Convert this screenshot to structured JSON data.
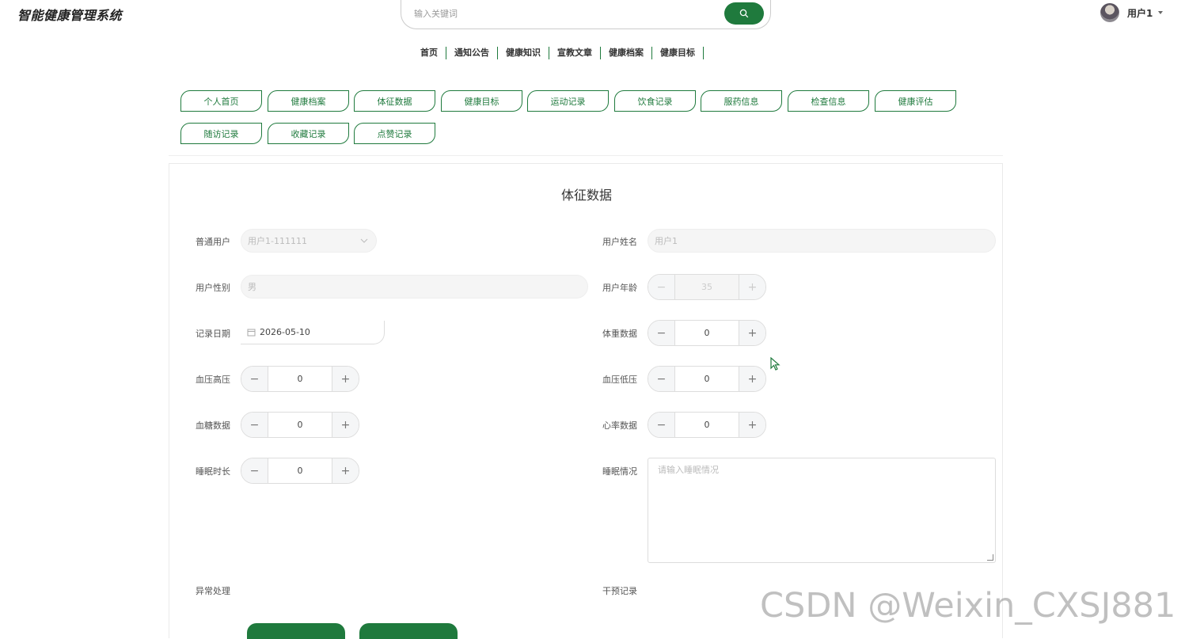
{
  "app": {
    "title": "智能健康管理系统"
  },
  "search": {
    "placeholder": "输入关键词"
  },
  "user": {
    "name": "用户1"
  },
  "nav": [
    "首页",
    "通知公告",
    "健康知识",
    "宣教文章",
    "健康档案",
    "健康目标"
  ],
  "tabs": [
    "个人首页",
    "健康档案",
    "体征数据",
    "健康目标",
    "运动记录",
    "饮食记录",
    "服药信息",
    "检查信息",
    "健康评估",
    "随访记录",
    "收藏记录",
    "点赞记录"
  ],
  "form": {
    "title": "体征数据",
    "user_label": "普通用户",
    "user_value": "用户1-111111",
    "name_label": "用户姓名",
    "name_value": "用户1",
    "gender_label": "用户性别",
    "gender_value": "男",
    "age_label": "用户年龄",
    "age_value": "35",
    "date_label": "记录日期",
    "date_value": "2026-05-10",
    "weight_label": "体重数据",
    "weight_value": "0",
    "bp_high_label": "血压高压",
    "bp_high_value": "0",
    "bp_low_label": "血压低压",
    "bp_low_value": "0",
    "sugar_label": "血糖数据",
    "sugar_value": "0",
    "heart_label": "心率数据",
    "heart_value": "0",
    "sleep_len_label": "睡眠时长",
    "sleep_len_value": "0",
    "sleep_cond_label": "睡眠情况",
    "sleep_cond_placeholder": "请输入睡眠情况",
    "abnormal_label": "异常处理",
    "intervention_label": "干预记录"
  },
  "watermark": "CSDN @Weixin_CXSJ881",
  "colors": {
    "accent": "#1f7a3d"
  }
}
